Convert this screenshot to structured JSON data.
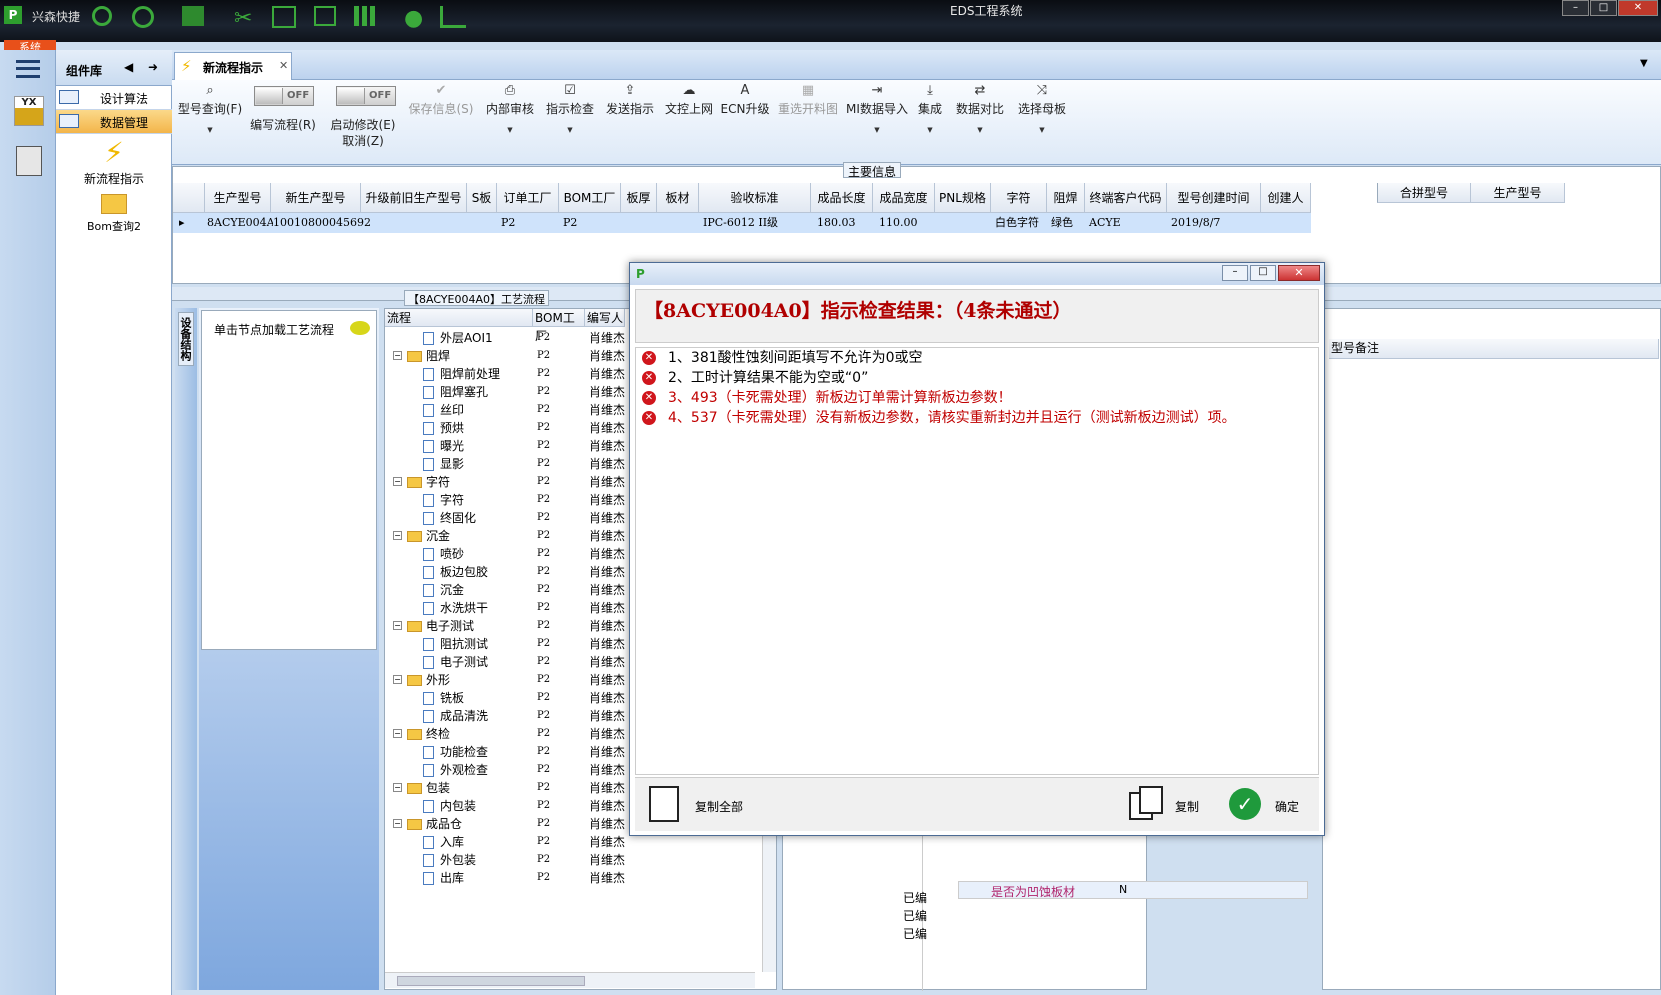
{
  "app": {
    "title": "EDS工程系统",
    "system_tab": "系统",
    "quick_label": "兴森快捷"
  },
  "panel": {
    "title": "组件库",
    "items": [
      {
        "label": "设计算法"
      },
      {
        "label": "数据管理"
      }
    ],
    "tools": [
      {
        "label": "新流程指示"
      },
      {
        "label": "Bom查询2"
      }
    ]
  },
  "doc_tab": {
    "label": "新流程指示"
  },
  "toolbar": {
    "buttons": [
      {
        "label": "型号查询(F)"
      },
      {
        "label": "编写流程(R)"
      },
      {
        "label": "启动修改(E)"
      },
      {
        "label": "取消(Z)"
      },
      {
        "label": "保存信息(S)"
      },
      {
        "label": "内部审核"
      },
      {
        "label": "指示检查"
      },
      {
        "label": "发送指示"
      },
      {
        "label": "文控上网"
      },
      {
        "label": "ECN升级"
      },
      {
        "label": "重选开料图"
      },
      {
        "label": "MI数据导入"
      },
      {
        "label": "集成"
      },
      {
        "label": "数据对比"
      },
      {
        "label": "选择母板"
      }
    ],
    "toggle_off": "OFF"
  },
  "main_info": {
    "title": "主要信息",
    "columns": [
      "生产型号",
      "新生产型号",
      "升级前旧生产型号",
      "S板",
      "订单工厂",
      "BOM工厂",
      "板厚",
      "板材",
      "验收标准",
      "成品长度",
      "成品宽度",
      "PNL规格",
      "字符",
      "阻焊",
      "终端客户代码",
      "型号创建时间",
      "创建人"
    ],
    "row": [
      "8ACYE004A0",
      "10010800045692",
      "",
      "",
      "P2",
      "P2",
      "",
      "",
      "IPC-6012 II级",
      "180.03",
      "110.00",
      "",
      "白色字符",
      "绿色",
      "ACYE",
      "2019/8/7",
      ""
    ],
    "side_columns": [
      "合拼型号",
      "生产型号"
    ]
  },
  "process": {
    "title": "【8ACYE004A0】工艺流程",
    "side_tab": "设备结构",
    "hint": "单击节点加载工艺流程",
    "columns": [
      "流程",
      "BOM工厂",
      "编写人"
    ],
    "rows": [
      {
        "name": "外层AOI1",
        "level": 2,
        "bom": "P2",
        "writer": "肖维杰"
      },
      {
        "name": "阻焊",
        "level": 1,
        "bom": "P2",
        "writer": "肖维杰"
      },
      {
        "name": "阻焊前处理",
        "level": 2,
        "bom": "P2",
        "writer": "肖维杰"
      },
      {
        "name": "阻焊塞孔",
        "level": 2,
        "bom": "P2",
        "writer": "肖维杰"
      },
      {
        "name": "丝印",
        "level": 2,
        "bom": "P2",
        "writer": "肖维杰"
      },
      {
        "name": "预烘",
        "level": 2,
        "bom": "P2",
        "writer": "肖维杰"
      },
      {
        "name": "曝光",
        "level": 2,
        "bom": "P2",
        "writer": "肖维杰"
      },
      {
        "name": "显影",
        "level": 2,
        "bom": "P2",
        "writer": "肖维杰"
      },
      {
        "name": "字符",
        "level": 1,
        "bom": "P2",
        "writer": "肖维杰"
      },
      {
        "name": "字符",
        "level": 2,
        "bom": "P2",
        "writer": "肖维杰"
      },
      {
        "name": "终固化",
        "level": 2,
        "bom": "P2",
        "writer": "肖维杰"
      },
      {
        "name": "沉金",
        "level": 1,
        "bom": "P2",
        "writer": "肖维杰"
      },
      {
        "name": "喷砂",
        "level": 2,
        "bom": "P2",
        "writer": "肖维杰"
      },
      {
        "name": "板边包胶",
        "level": 2,
        "bom": "P2",
        "writer": "肖维杰"
      },
      {
        "name": "沉金",
        "level": 2,
        "bom": "P2",
        "writer": "肖维杰"
      },
      {
        "name": "水洗烘干",
        "level": 2,
        "bom": "P2",
        "writer": "肖维杰"
      },
      {
        "name": "电子测试",
        "level": 1,
        "bom": "P2",
        "writer": "肖维杰"
      },
      {
        "name": "阻抗测试",
        "level": 2,
        "bom": "P2",
        "writer": "肖维杰"
      },
      {
        "name": "电子测试",
        "level": 2,
        "bom": "P2",
        "writer": "肖维杰"
      },
      {
        "name": "外形",
        "level": 1,
        "bom": "P2",
        "writer": "肖维杰"
      },
      {
        "name": "铣板",
        "level": 2,
        "bom": "P2",
        "writer": "肖维杰"
      },
      {
        "name": "成品清洗",
        "level": 2,
        "bom": "P2",
        "writer": "肖维杰"
      },
      {
        "name": "终检",
        "level": 1,
        "bom": "P2",
        "writer": "肖维杰"
      },
      {
        "name": "功能检查",
        "level": 2,
        "bom": "P2",
        "writer": "肖维杰"
      },
      {
        "name": "外观检查",
        "level": 2,
        "bom": "P2",
        "writer": "肖维杰"
      },
      {
        "name": "包装",
        "level": 1,
        "bom": "P2",
        "writer": "肖维杰"
      },
      {
        "name": "内包装",
        "level": 2,
        "bom": "P2",
        "writer": "肖维杰"
      },
      {
        "name": "成品仓",
        "level": 1,
        "bom": "P2",
        "writer": "肖维杰"
      },
      {
        "name": "入库",
        "level": 2,
        "bom": "P2",
        "writer": "肖维杰"
      },
      {
        "name": "外包装",
        "level": 2,
        "bom": "P2",
        "writer": "肖维杰"
      },
      {
        "name": "出库",
        "level": 2,
        "bom": "P2",
        "writer": "肖维杰"
      }
    ],
    "status_partial": "已编",
    "prop_label": "是否为凹蚀板材",
    "prop_value": "N"
  },
  "right_pane": {
    "column": "型号备注"
  },
  "dialog": {
    "header": "【8ACYE004A0】指示检查结果：（4条未通过）",
    "errors": [
      {
        "text": "1、381酸性蚀刻间距填写不允许为0或空",
        "color": "#000000"
      },
      {
        "text": "2、工时计算结果不能为空或“0”",
        "color": "#000000"
      },
      {
        "text": "3、493（卡死需处理）新板边订单需计算新板边参数！",
        "color": "#c00000"
      },
      {
        "text": "4、537（卡死需处理）没有新板边参数，请核实重新封边并且运行（测试新板边测试）项。",
        "color": "#c00000"
      }
    ],
    "copy_all_label": "复制全部",
    "copy_label": "复制",
    "ok_label": "确定"
  },
  "colors": {
    "accent": "#b00000",
    "selection": "#cfe3fb",
    "nav_selected": "#f3b54a"
  }
}
